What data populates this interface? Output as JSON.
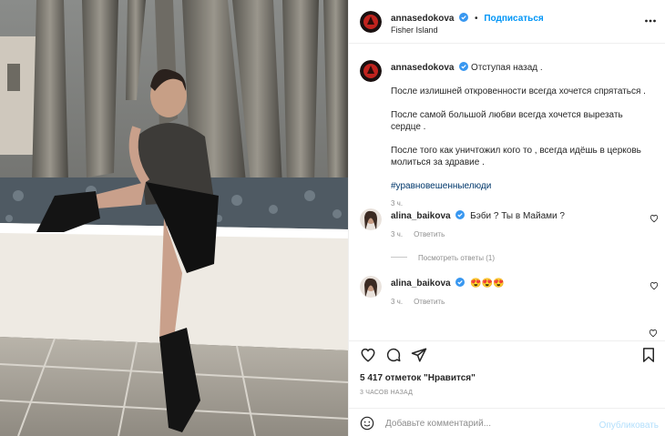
{
  "post_image": {
    "description_icon": "photo"
  },
  "header": {
    "username": "annasedokova",
    "follow_label": "Подписаться",
    "separator": "•",
    "location": "Fisher Island"
  },
  "caption": {
    "username": "annasedokova",
    "lines": [
      "Отступая назад .",
      "После излишней откровенности всегда хочется спрятаться .",
      "После самой большой любви всегда хочется вырезать сердце .",
      "После того как уничтожил кого то , всегда идёшь в церковь молиться за здравие ."
    ],
    "hashtag": "#уравновешенныелюди",
    "time": "3 ч."
  },
  "comments": [
    {
      "username": "alina_baikova",
      "text": "Бэби ? Ты в Майами ?",
      "time": "3 ч.",
      "reply_label": "Ответить"
    },
    {
      "username": "alina_baikova",
      "text": "😍😍😍",
      "time": "3 ч.",
      "reply_label": "Ответить"
    }
  ],
  "view_replies": "Посмотреть ответы (1)",
  "likes": "5 417 отметок \"Нравится\"",
  "posted_ago": "3 ЧАСОВ НАЗАД",
  "comment_form": {
    "placeholder": "Добавьте комментарий...",
    "publish_label": "Опубликовать"
  },
  "colors": {
    "accent": "#0095f6",
    "publish_disabled": "#b2dffc",
    "muted": "#8e8e8e",
    "hashtag": "#00376b"
  },
  "icons": [
    "more-icon",
    "heart-icon",
    "comment-icon",
    "share-icon",
    "bookmark-icon",
    "smile-icon",
    "verified-icon"
  ]
}
